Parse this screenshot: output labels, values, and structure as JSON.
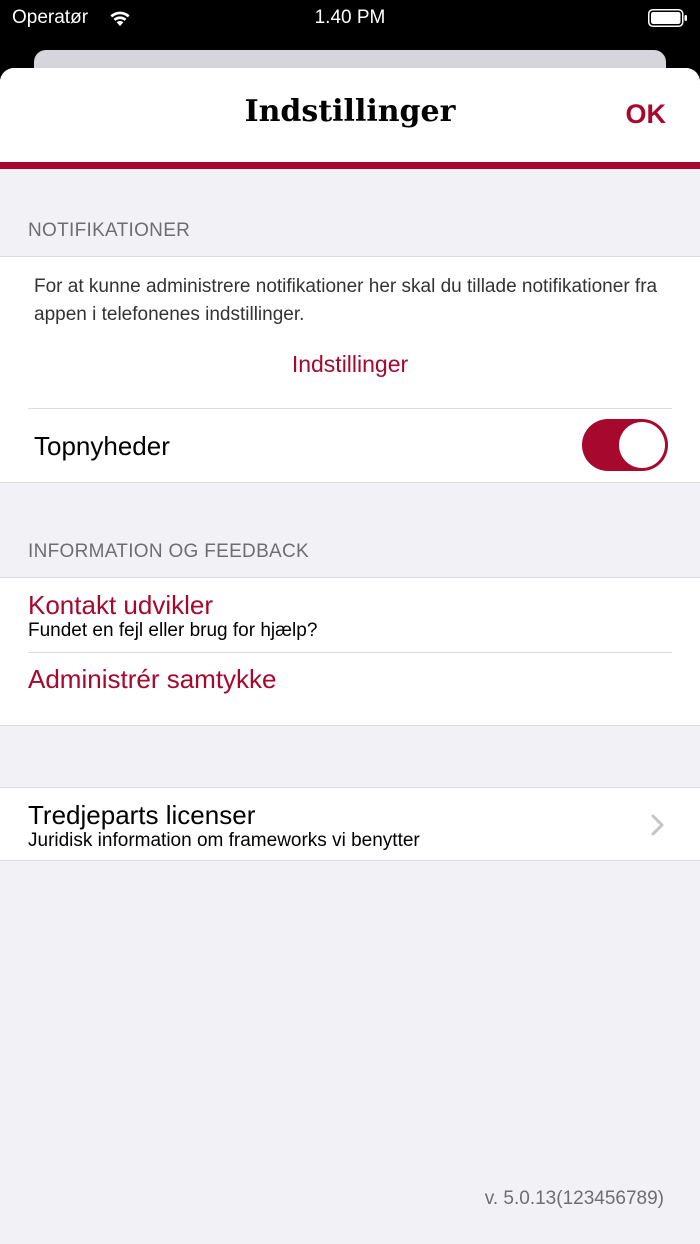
{
  "status_bar": {
    "carrier": "Operatør",
    "time": "1.40 PM"
  },
  "nav": {
    "title": "Indstillinger",
    "done_label": "OK"
  },
  "notifications": {
    "header": "NOTIFIKATIONER",
    "info_text": "For at kunne administrere notifikationer her skal du tillade notifikationer fra appen i telefonenes indstillinger.",
    "settings_link": "Indstillinger",
    "top_news_label": "Topnyheder",
    "top_news_enabled": true
  },
  "info_feedback": {
    "header": "INFORMATION OG FEEDBACK",
    "contact_title": "Kontakt udvikler",
    "contact_subtitle": "Fundet en fejl eller brug for hjælp?",
    "consent_title": "Administrér samtykke"
  },
  "licenses": {
    "title": "Tredjeparts licenser",
    "subtitle": "Juridisk information om frameworks vi benytter"
  },
  "version": "v. 5.0.13(123456789)",
  "colors": {
    "accent": "#a6082e",
    "background": "#f1f1f6",
    "secondary_text": "#6d6d72"
  }
}
